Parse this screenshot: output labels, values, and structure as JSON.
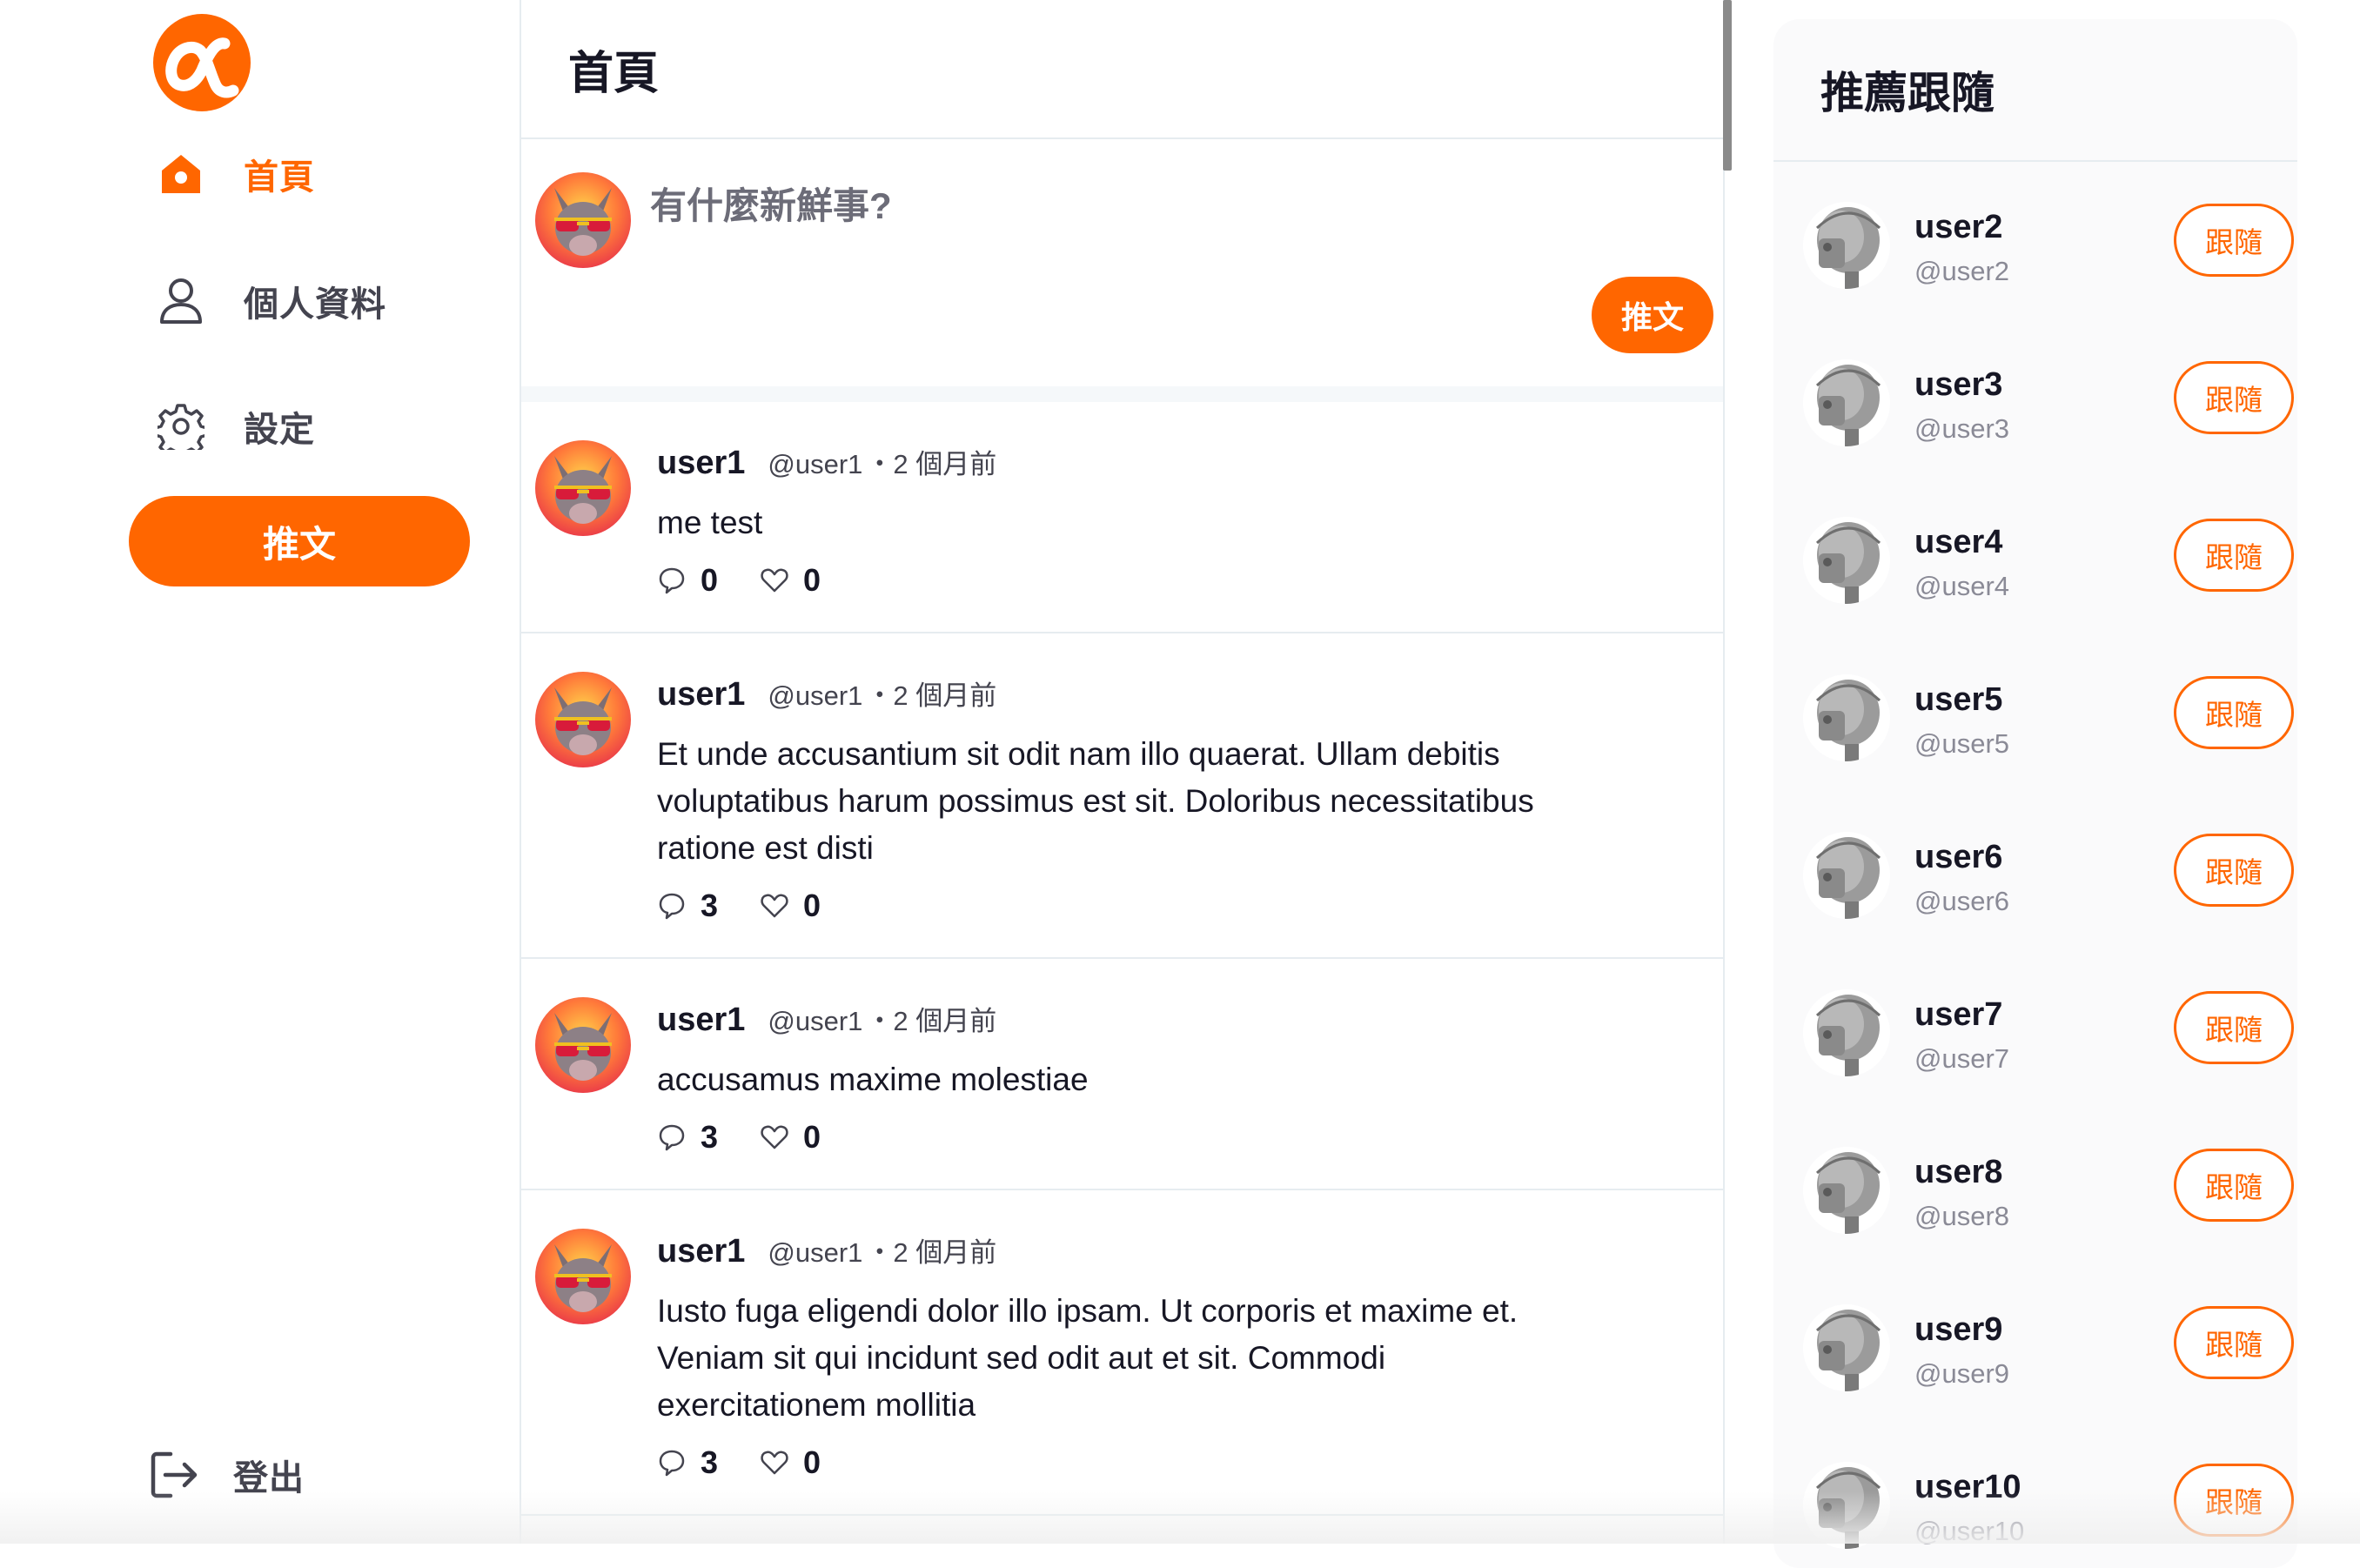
{
  "colors": {
    "brand": "#ff6600",
    "text": "#171725",
    "muted": "#8a8a96",
    "divider": "#e6ecf0"
  },
  "sidebar": {
    "logo": "alpha-logo",
    "items": [
      {
        "label": "首頁",
        "icon": "home-icon",
        "active": true
      },
      {
        "label": "個人資料",
        "icon": "user-icon",
        "active": false
      },
      {
        "label": "設定",
        "icon": "gear-icon",
        "active": false
      }
    ],
    "tweet_button": "推文",
    "logout": {
      "label": "登出",
      "icon": "logout-icon"
    }
  },
  "main": {
    "title": "首頁",
    "composer": {
      "placeholder": "有什麼新鮮事?",
      "submit": "推文"
    },
    "tweets": [
      {
        "name": "user1",
        "handle": "@user1",
        "time": "・2 個月前",
        "text": "me test",
        "replies": "0",
        "likes": "0"
      },
      {
        "name": "user1",
        "handle": "@user1",
        "time": "・2 個月前",
        "text": "Et unde accusantium sit odit nam illo quaerat. Ullam debitis voluptatibus harum possimus est sit. Doloribus necessitatibus ratione est disti",
        "replies": "3",
        "likes": "0"
      },
      {
        "name": "user1",
        "handle": "@user1",
        "time": "・2 個月前",
        "text": "accusamus maxime molestiae",
        "replies": "3",
        "likes": "0"
      },
      {
        "name": "user1",
        "handle": "@user1",
        "time": "・2 個月前",
        "text": "Iusto fuga eligendi dolor illo ipsam. Ut corporis et maxime et. Veniam sit qui incidunt sed odit aut et sit. Commodi exercitationem mollitia",
        "replies": "3",
        "likes": "0"
      }
    ]
  },
  "right_panel": {
    "title": "推薦跟隨",
    "follow_label": "跟隨",
    "users": [
      {
        "name": "user2",
        "handle": "@user2"
      },
      {
        "name": "user3",
        "handle": "@user3"
      },
      {
        "name": "user4",
        "handle": "@user4"
      },
      {
        "name": "user5",
        "handle": "@user5"
      },
      {
        "name": "user6",
        "handle": "@user6"
      },
      {
        "name": "user7",
        "handle": "@user7"
      },
      {
        "name": "user8",
        "handle": "@user8"
      },
      {
        "name": "user9",
        "handle": "@user9"
      },
      {
        "name": "user10",
        "handle": "@user10"
      }
    ]
  }
}
